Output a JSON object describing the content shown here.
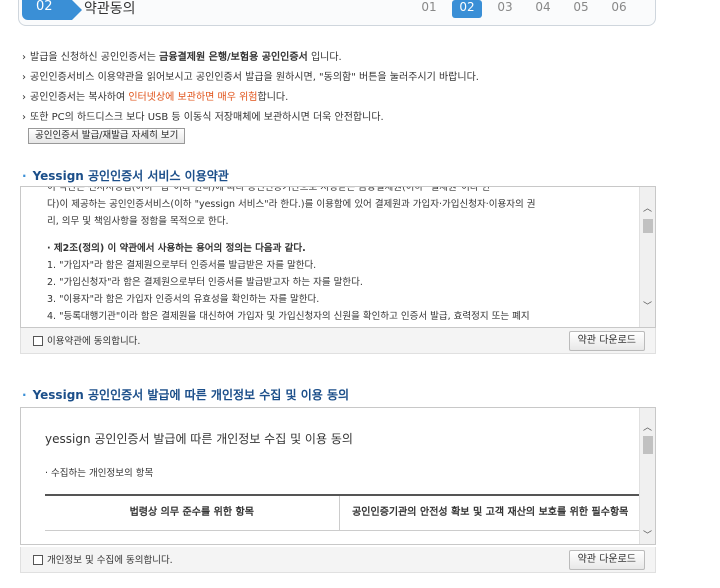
{
  "header": {
    "step_number": "02",
    "step_title": "약관동의",
    "steps": [
      "01",
      "02",
      "03",
      "04",
      "05",
      "06"
    ],
    "active_step": "02"
  },
  "notes": {
    "n1_pre": "발급을 신청하신 공인인증서는 ",
    "n1_bold": "금융결제원 은행/보험용 공인인증서",
    "n1_post": " 입니다.",
    "n2": "공인인증서비스 이용약관을 읽어보시고 공인인증서 발급을 원하시면, \"동의함\" 버튼을 눌러주시기 바랍니다.",
    "n3_pre": "공인인증서는 복사하여 ",
    "n3_warn": "인터넷상에 보관하면 매우 위험",
    "n3_post": "합니다.",
    "n4": "또한 PC의 하드디스크 보다 USB 등 이동식 저장매체에 보관하시면 더욱 안전합니다.",
    "detail_button": "공인인증서 발급/재발급 자세히 보기"
  },
  "terms": {
    "title": "Yessign 공인인증서 서비스 이용약관",
    "line0": "이 약관은 전자서명법(이하 \"법\"이라 한다)에 따라 공인인증기관으로 지정받은 금융결제원(이하 \"결제원\"이라 한",
    "line1": "다)이 제공하는 공인인증서비스(이하 \"yessign 서비스\"라 한다.)를 이용함에 있어 결제원과 가입자·가입신청자·이용자의 권",
    "line2": "리, 의무 및 책임사항을 정함을 목적으로 한다.",
    "article2_head": "제2조(정의) 이 약관에서 사용하는 용어의 정의는 다음과 같다.",
    "item1": "1. \"가입자\"라 함은 결제원으로부터 인증서를 발급받은 자를 말한다.",
    "item2": "2. \"가입신청자\"라 함은 결제원으로부터 인증서를 발급받고자 하는 자를 말한다.",
    "item3": "3. \"이용자\"라 함은 가입자 인증서의 유효성을 확인하는 자를 말한다.",
    "item4": "4. \"등록대행기관\"이라 함은 결제원을 대신하여 가입자 및 가입신청자의 신원을 확인하고 인증서 발급, 효력정지 또는 폐지",
    "agree_label": "이용약관에 동의합니다.",
    "download_button": "약관 다운로드"
  },
  "privacy": {
    "title": "Yessign 공인인증서 발급에 따른 개인정보 수집 및 이용 동의",
    "inner_title": "yessign 공인인증서 발급에 따른 개인정보 수집 및 이용 동의",
    "subhead": "수집하는 개인정보의 항목",
    "col1": "법령상 의무 준수를 위한 항목",
    "col2": "공인인증기관의 안전성 확보 및 고객 재산의 보호를 위한 필수항목",
    "agree_label": "개인정보 및 수집에 동의합니다.",
    "download_button": "약관 다운로드"
  }
}
